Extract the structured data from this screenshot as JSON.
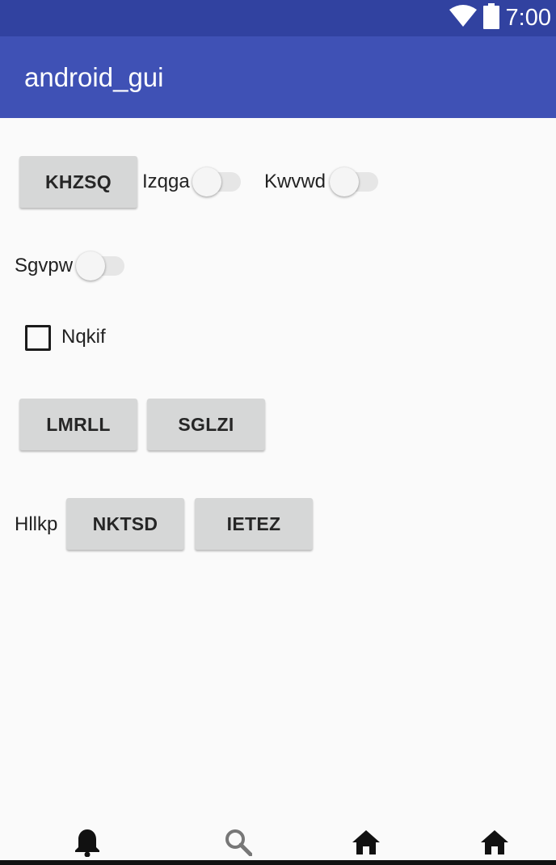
{
  "status_bar": {
    "time": "7:00",
    "icons": [
      "wifi-icon",
      "battery-icon"
    ],
    "colors": {
      "background": "#3142a0",
      "foreground": "#ffffff"
    }
  },
  "app_bar": {
    "title": "android_gui",
    "color": "#3f51b5"
  },
  "content": {
    "button_khzsq": "KHZSQ",
    "switch_izqga": {
      "label": "Izqga",
      "checked": false
    },
    "switch_kwvwd": {
      "label": "Kwvwd",
      "checked": false
    },
    "switch_sgvpw": {
      "label": "Sgvpw",
      "checked": false
    },
    "checkbox_nqkif": {
      "label": "Nqkif",
      "checked": false
    },
    "button_lmrll": "LMRLL",
    "button_sglzi": "SGLZI",
    "label_hllkp": "Hllkp",
    "button_nktsd": "NKTSD",
    "button_ietez": "IETEZ"
  },
  "bottom_nav": {
    "items": [
      {
        "icon": "bell-icon",
        "active": true
      },
      {
        "icon": "search-icon",
        "active": false
      },
      {
        "icon": "home-icon",
        "active": true
      },
      {
        "icon": "home-icon",
        "active": true
      }
    ]
  }
}
